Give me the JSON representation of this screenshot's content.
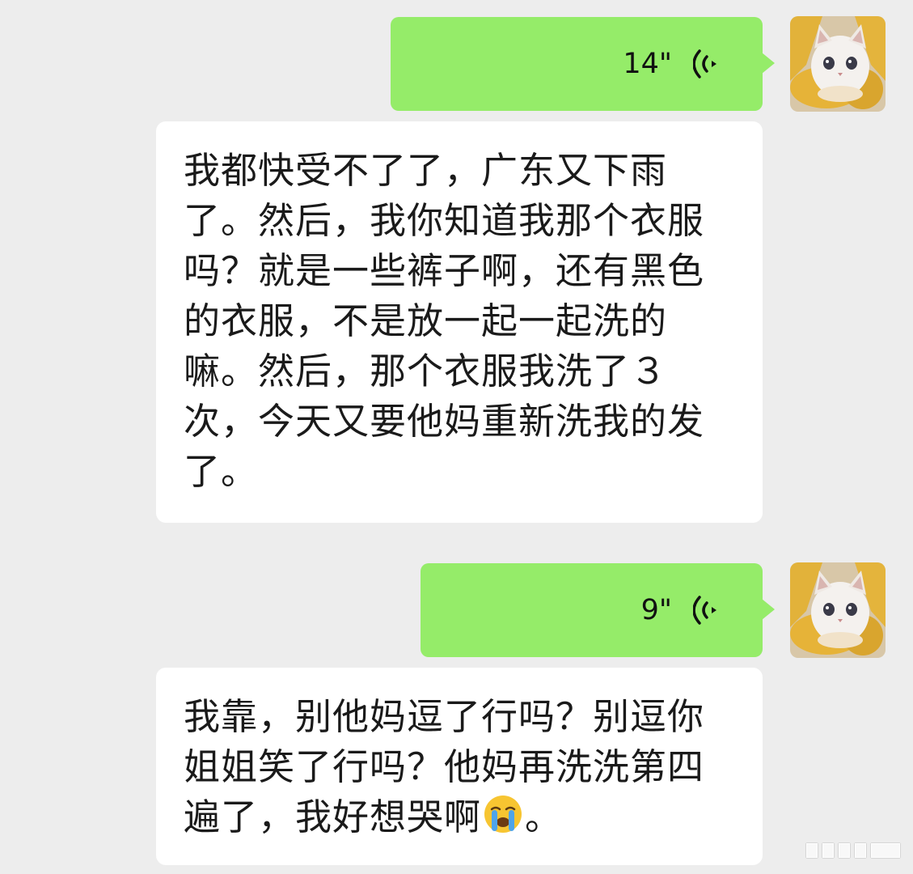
{
  "chat": {
    "messages": [
      {
        "type": "voice",
        "sender": "self",
        "duration": "14\"",
        "icon": "voice-wave-icon",
        "avatar": "cat-avatar"
      },
      {
        "type": "text",
        "sender": "other",
        "text": "我都快受不了了，广东又下雨了。然后，我你知道我那个衣服吗？就是一些裤子啊，还有黑色的衣服，不是放一起一起洗的嘛。然后，那个衣服我洗了３次，今天又要他妈重新洗我的发了。"
      },
      {
        "type": "voice",
        "sender": "self",
        "duration": "9\"",
        "icon": "voice-wave-icon",
        "avatar": "cat-avatar"
      },
      {
        "type": "text",
        "sender": "other",
        "text_before_emoji": "我靠，别他妈逗了行吗？别逗你姐姐笑了行吗？他妈再洗洗第四遍了，我好想哭啊",
        "emoji": "crying-face-emoji",
        "text_after_emoji": "。"
      }
    ]
  },
  "colors": {
    "background": "#ededed",
    "self_bubble": "#95ec69",
    "other_bubble": "#ffffff",
    "text": "#1a1a1a"
  }
}
